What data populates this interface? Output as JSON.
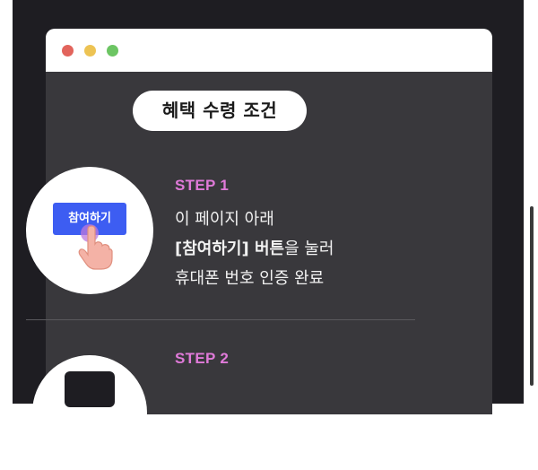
{
  "window": {
    "controls": [
      "close",
      "minimize",
      "maximize"
    ]
  },
  "section": {
    "title": "혜택 수령 조건"
  },
  "steps": [
    {
      "label": "STEP 1",
      "line1": "이 페이지 아래",
      "line2_bold": "[참여하기] 버튼",
      "line2_rest": "을 눌러",
      "line3": "휴대폰 번호 인증 완료",
      "illustration_button": "참여하기",
      "illustration_icon": "tap-hand-icon"
    },
    {
      "label": "STEP 2"
    }
  ],
  "colors": {
    "page_background": "#1e1d22",
    "panel_background": "#39383c",
    "step_accent": "#e07ad9",
    "illustration_button": "#3d5df2",
    "close_dot": "#e2645c",
    "minimize_dot": "#edc353",
    "maximize_dot": "#6cc563"
  }
}
